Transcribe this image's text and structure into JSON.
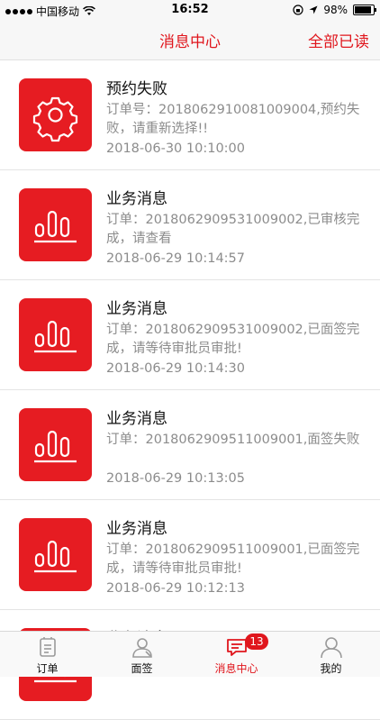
{
  "status_bar": {
    "carrier": "中国移动",
    "time": "16:52",
    "battery": "98%"
  },
  "header": {
    "title": "消息中心",
    "action": "全部已读"
  },
  "messages": [
    {
      "icon": "gear-icon",
      "title": "预约失败",
      "body": "订单号：2018062910081009004,预约失败，请重新选择!!",
      "time": "2018-06-30 10:10:00"
    },
    {
      "icon": "bar-chart-icon",
      "title": "业务消息",
      "body": "订单：2018062909531009002,已审核完成，请查看",
      "time": "2018-06-29 10:14:57"
    },
    {
      "icon": "bar-chart-icon",
      "title": "业务消息",
      "body": "订单：2018062909531009002,已面签完成，请等待审批员审批!",
      "time": "2018-06-29 10:14:30"
    },
    {
      "icon": "bar-chart-icon",
      "title": "业务消息",
      "body": "订单：2018062909511009001,面签失败",
      "time": "2018-06-29 10:13:05"
    },
    {
      "icon": "bar-chart-icon",
      "title": "业务消息",
      "body": "订单：2018062909511009001,已面签完成，请等待审批员审批!",
      "time": "2018-06-29 10:12:13"
    },
    {
      "icon": "bar-chart-icon",
      "title": "业务消息",
      "body": "",
      "time": ""
    }
  ],
  "tabs": [
    {
      "label": "订单",
      "icon": "order-icon"
    },
    {
      "label": "面签",
      "icon": "sign-icon"
    },
    {
      "label": "消息中心",
      "icon": "message-icon",
      "badge": "13",
      "active": true
    },
    {
      "label": "我的",
      "icon": "profile-icon"
    }
  ],
  "colors": {
    "accent": "#e0161d",
    "thumb": "#e61c22",
    "secondary_text": "#8c8c8c"
  }
}
